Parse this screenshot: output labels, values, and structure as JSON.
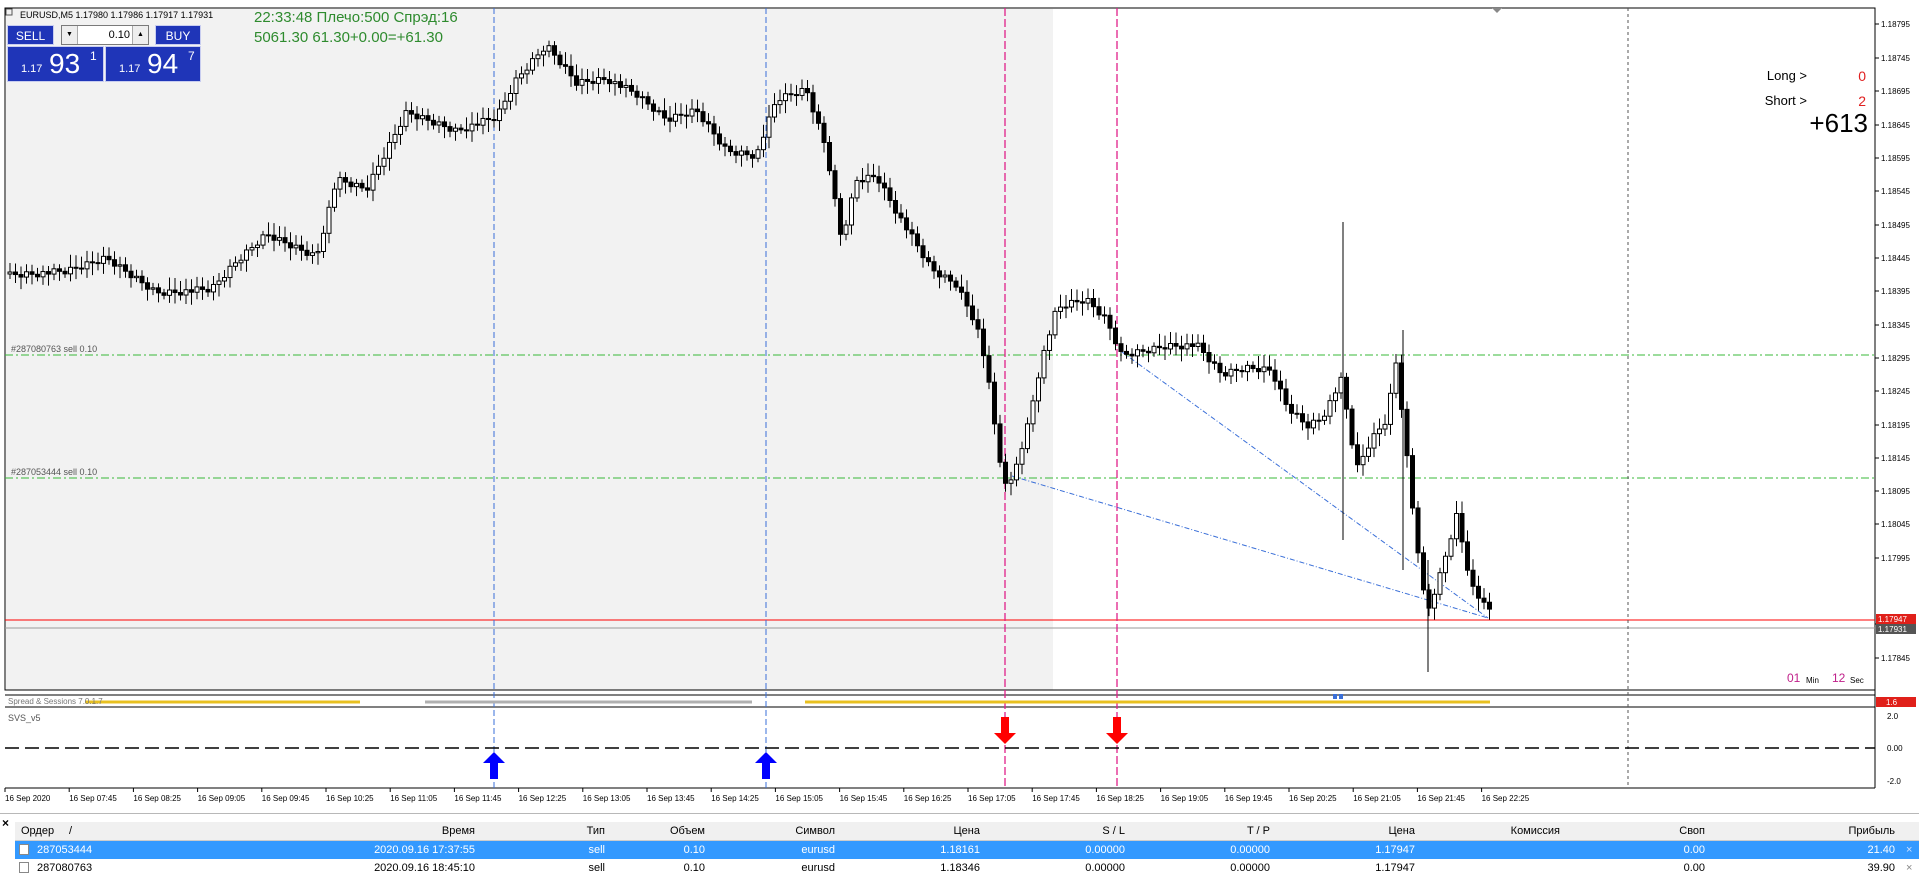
{
  "chart": {
    "header": "EURUSD,M5  1.17980 1.17986 1.17917 1.17931",
    "info_line1": "22:33:48 Плечо:500 Спрэд:16",
    "info_line2": "5061.30   61.30+0.00=+61.30",
    "long_label": "Long >",
    "long_value": "0",
    "short_label": "Short >",
    "short_value": "2",
    "profit": "+613",
    "timer_min_val": "01",
    "timer_min_label": "Min",
    "timer_sec_val": "12",
    "timer_sec_label": "Sec",
    "order_line_1_label": "#287080763 sell 0.10",
    "order_line_2_label": "#287053444 sell 0.10",
    "bid_tag": "1.17947",
    "ask_tag": "1.17931",
    "spread_tag": "1.6",
    "subwindow1_label": "Spread & Sessions 7.0.1.7",
    "subwindow2_label": "SVS_v5",
    "colors": {
      "bull_arrow": "#0000ff",
      "bear_arrow": "#ff0000",
      "info_text": "#2e8b2e",
      "order_line": "#38b838",
      "vline_blue": "#3a6fd8",
      "vline_magenta": "#e0208a"
    }
  },
  "price_axis": [
    "1.18795",
    "1.18745",
    "1.18695",
    "1.18645",
    "1.18595",
    "1.18545",
    "1.18495",
    "1.18445",
    "1.18395",
    "1.18345",
    "1.18295",
    "1.18245",
    "1.18195",
    "1.18145",
    "1.18095",
    "1.18045",
    "1.17995",
    "1.17895",
    "1.17845"
  ],
  "indicator_axis": [
    "2.0",
    "0.00",
    "-2.0"
  ],
  "time_axis": [
    "16 Sep 2020",
    "16 Sep 07:45",
    "16 Sep 08:25",
    "16 Sep 09:05",
    "16 Sep 09:45",
    "16 Sep 10:25",
    "16 Sep 11:05",
    "16 Sep 11:45",
    "16 Sep 12:25",
    "16 Sep 13:05",
    "16 Sep 13:45",
    "16 Sep 14:25",
    "16 Sep 15:05",
    "16 Sep 15:45",
    "16 Sep 16:25",
    "16 Sep 17:05",
    "16 Sep 17:45",
    "16 Sep 18:25",
    "16 Sep 19:05",
    "16 Sep 19:45",
    "16 Sep 20:25",
    "16 Sep 21:05",
    "16 Sep 21:45",
    "16 Sep 22:25"
  ],
  "one_click": {
    "sell_label": "SELL",
    "buy_label": "BUY",
    "volume": "0.10",
    "sell_price_small": "1.17",
    "sell_price_big": "93",
    "sell_price_sup": "1",
    "buy_price_small": "1.17",
    "buy_price_big": "94",
    "buy_price_sup": "7"
  },
  "orders_table": {
    "headers": [
      "Ордер",
      "/",
      "Время",
      "Тип",
      "Объем",
      "Символ",
      "Цена",
      "S / L",
      "T / P",
      "Цена",
      "Комиссия",
      "Своп",
      "Прибыль"
    ],
    "rows": [
      [
        "287053444",
        "2020.09.16 17:37:55",
        "sell",
        "0.10",
        "eurusd",
        "1.18161",
        "0.00000",
        "0.00000",
        "1.17947",
        "",
        "0.00",
        "21.40"
      ],
      [
        "287080763",
        "2020.09.16 18:45:10",
        "sell",
        "0.10",
        "eurusd",
        "1.18346",
        "0.00000",
        "0.00000",
        "1.17947",
        "",
        "0.00",
        "39.90"
      ]
    ]
  }
}
